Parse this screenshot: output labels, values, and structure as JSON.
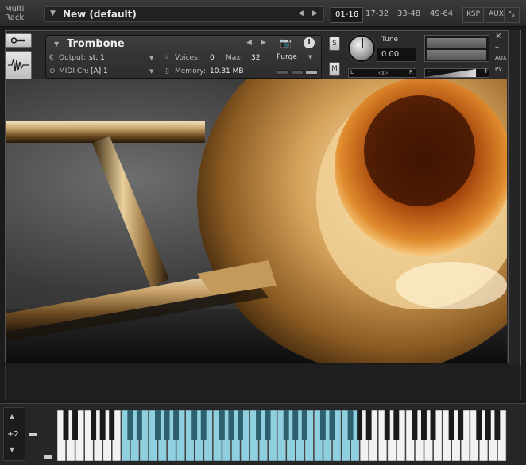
{
  "rack": {
    "multi_label": "Multi\nRack",
    "name": "New (default)",
    "pages": [
      "01-16",
      "17-32",
      "33-48",
      "49-64"
    ],
    "active_page": "01-16",
    "buttons": [
      "KSP",
      "AUX"
    ]
  },
  "instrument": {
    "name": "Trombone",
    "output_label": "Output:",
    "output_value": "st. 1",
    "voices_label": "Voices:",
    "voices_value": "0",
    "max_label": "Max:",
    "max_value": "32",
    "midi_label": "MIDI Ch:",
    "midi_value": "[A]  1",
    "memory_label": "Memory:",
    "memory_value": "10.31 MB",
    "purge_label": "Purge",
    "solo_label": "S",
    "mute_label": "M",
    "tune_label": "Tune",
    "tune_value": "0.00",
    "pan_left": "L",
    "pan_right": "R",
    "aux_label": "AUX",
    "pv_label": "PV",
    "close_label": "×",
    "minimize_label": "–"
  },
  "keyboard": {
    "octave_label": "+2",
    "highlight_color": "#8ecfe0"
  },
  "icons": [
    "wrench-icon",
    "waveform-icon",
    "camera-icon",
    "info-icon",
    "dropdown-arrow-icon",
    "arrow-left-icon",
    "arrow-right-icon",
    "collapse-icon"
  ]
}
